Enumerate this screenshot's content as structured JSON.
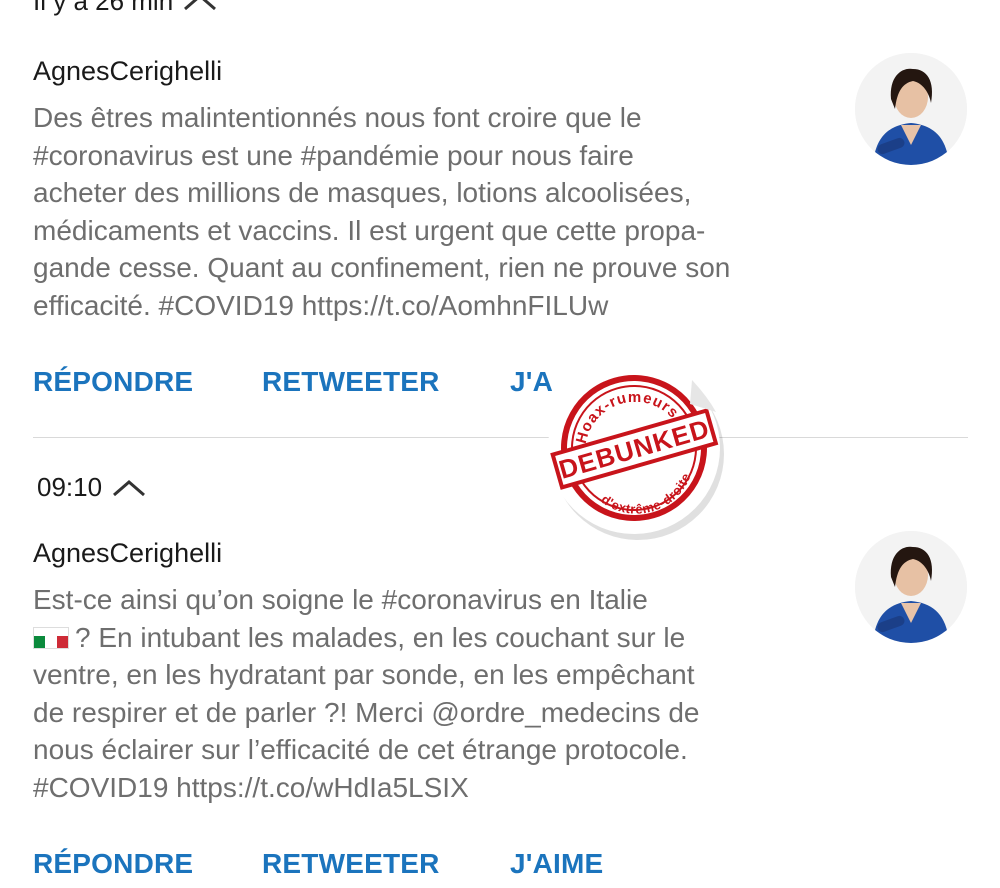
{
  "tweets": [
    {
      "timestamp": "Il y a 26 min",
      "author": "AgnesCerighelli",
      "lines": [
        "Des êtres malintentionnés nous font croire que le",
        "#coronavirus est une #pandémie pour nous faire",
        "acheter des millions de masques, lotions alcoolisées,",
        "médicaments et vaccins. Il est urgent que cette propa-",
        "gande cesse. Quant au confinement, rien ne prouve son",
        "efficacité. #COVID19 https://t.co/AomhnFILUw"
      ],
      "actions": {
        "reply": "RÉPONDRE",
        "retweet": "RETWEETER",
        "like": "J'A"
      }
    },
    {
      "timestamp": "09:10",
      "author": "AgnesCerighelli",
      "lines": [
        "Est-ce ainsi qu’on soigne le #coronavirus en Italie",
        "? En intubant les malades, en les couchant sur le",
        "ventre, en les hydratant par sonde, en les empêchant",
        "de respirer et de parler ?! Merci @ordre_medecins de",
        "nous éclairer sur l’efficacité de cet étrange protocole.",
        "#COVID19 https://t.co/wHdIa5LSIX"
      ],
      "actions": {
        "reply": "RÉPONDRE",
        "retweet": "RETWEETER",
        "like": "J'AIME"
      }
    }
  ],
  "stamp": {
    "top_text": "Hoax-rumeurs",
    "center_text": "DEBUNKED",
    "bottom_text": "d'extrême-droite",
    "color": "#c8141b"
  },
  "colors": {
    "accent": "#1b74bd",
    "text_muted": "#6e6e6e",
    "text_dark": "#1a1a1a"
  },
  "icons": [
    "chevron-up-icon",
    "italy-flag-icon",
    "avatar"
  ]
}
